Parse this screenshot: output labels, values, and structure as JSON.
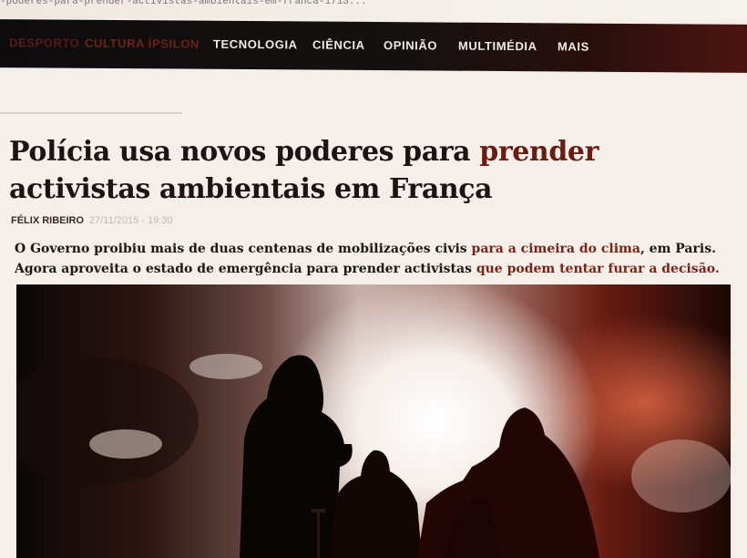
{
  "browser": {
    "url": "-poderes-para-prender-activistas-ambientais-em-franca-1713..."
  },
  "nav": {
    "items": [
      {
        "label": "DESPORTO",
        "state": "faded"
      },
      {
        "label": "CULTURA ÍPSILON",
        "state": "dim"
      },
      {
        "label": "TECNOLOGIA",
        "state": "normal"
      },
      {
        "label": "CIÊNCIA",
        "state": "normal"
      },
      {
        "label": "OPINIÃO",
        "state": "normal"
      },
      {
        "label": "MULTIMÉDIA",
        "state": "normal"
      },
      {
        "label": "MAIS",
        "state": "normal"
      }
    ]
  },
  "article": {
    "headline_part1": "Polícia usa novos poderes para ",
    "headline_accent": "prender",
    "headline_part2": " activistas ambientais em França",
    "author": "FÉLIX RIBEIRO",
    "date": "27/11/2015 - 19:30",
    "lead_part1": "O Governo proibiu mais de duas centenas de mobilizações civis ",
    "lead_accent1": "para a cimeira do clima",
    "lead_part2": ", em Paris. Agora aproveita o estado de emergência para prender activistas ",
    "lead_accent2": "que podem tentar furar a decisão.",
    "photo_description_icon": "photo-silhouettes"
  },
  "colors": {
    "nav_bg": "#0d0b0b",
    "accent": "#6a1c12",
    "text": "#1c1414"
  }
}
